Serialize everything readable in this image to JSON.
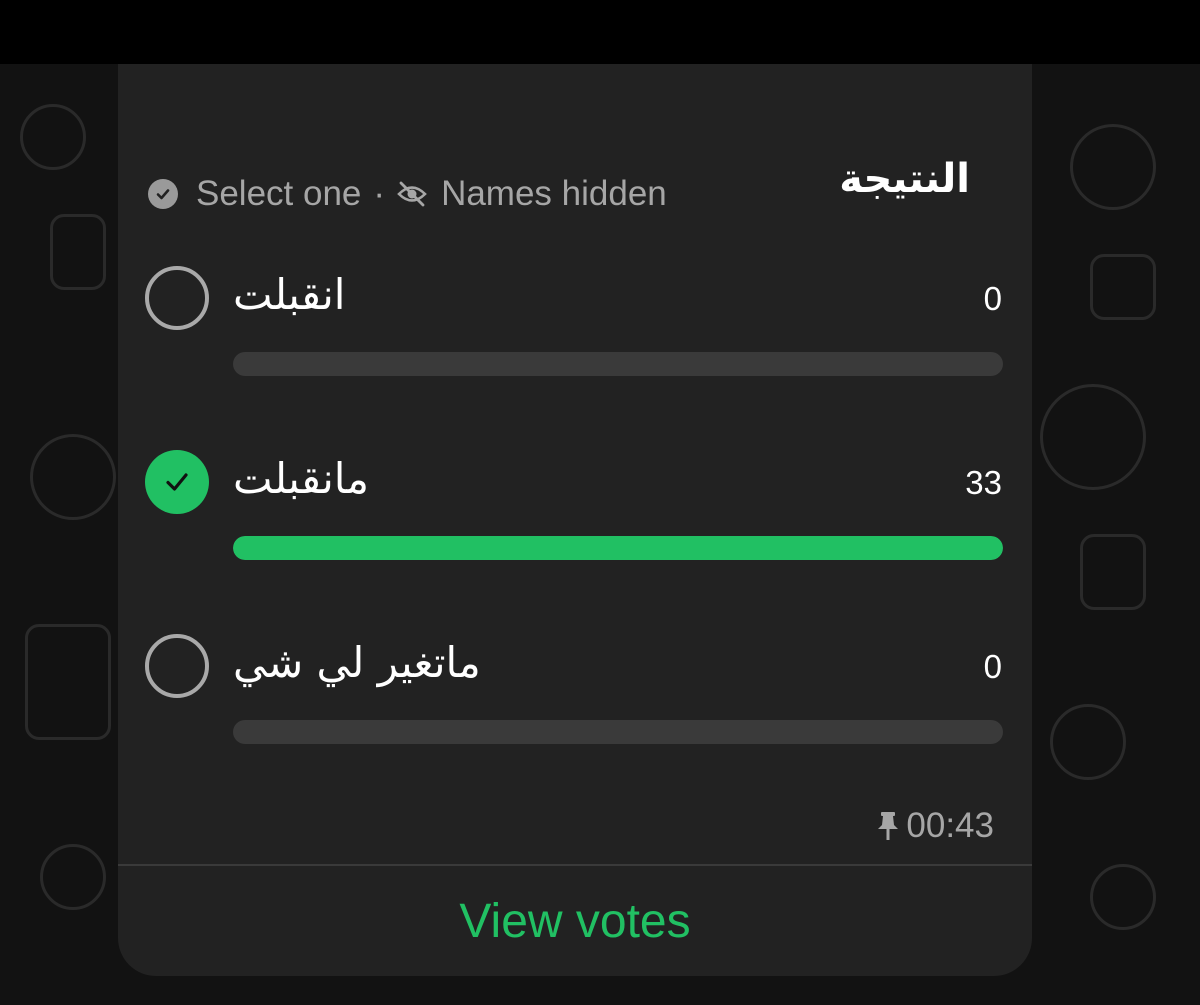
{
  "poll": {
    "title": "النتيجة",
    "meta": {
      "select_text": "Select one",
      "separator": "·",
      "names_text": "Names hidden",
      "select_icon": "check-circle-icon",
      "names_icon": "eye-off-icon"
    },
    "options": [
      {
        "label": "انقبلت",
        "count": "0",
        "selected": false,
        "share": 0
      },
      {
        "label": "مانقبلت",
        "count": "33",
        "selected": true,
        "share": 1
      },
      {
        "label": "ماتغير لي شي",
        "count": "0",
        "selected": false,
        "share": 0
      }
    ],
    "time": "00:43",
    "time_icon": "pin-icon",
    "view_votes_label": "View votes"
  },
  "colors": {
    "accent": "#21c063",
    "card_bg": "#222222",
    "bar_bg": "#3a3a3a",
    "muted_text": "#a6a6a6"
  }
}
